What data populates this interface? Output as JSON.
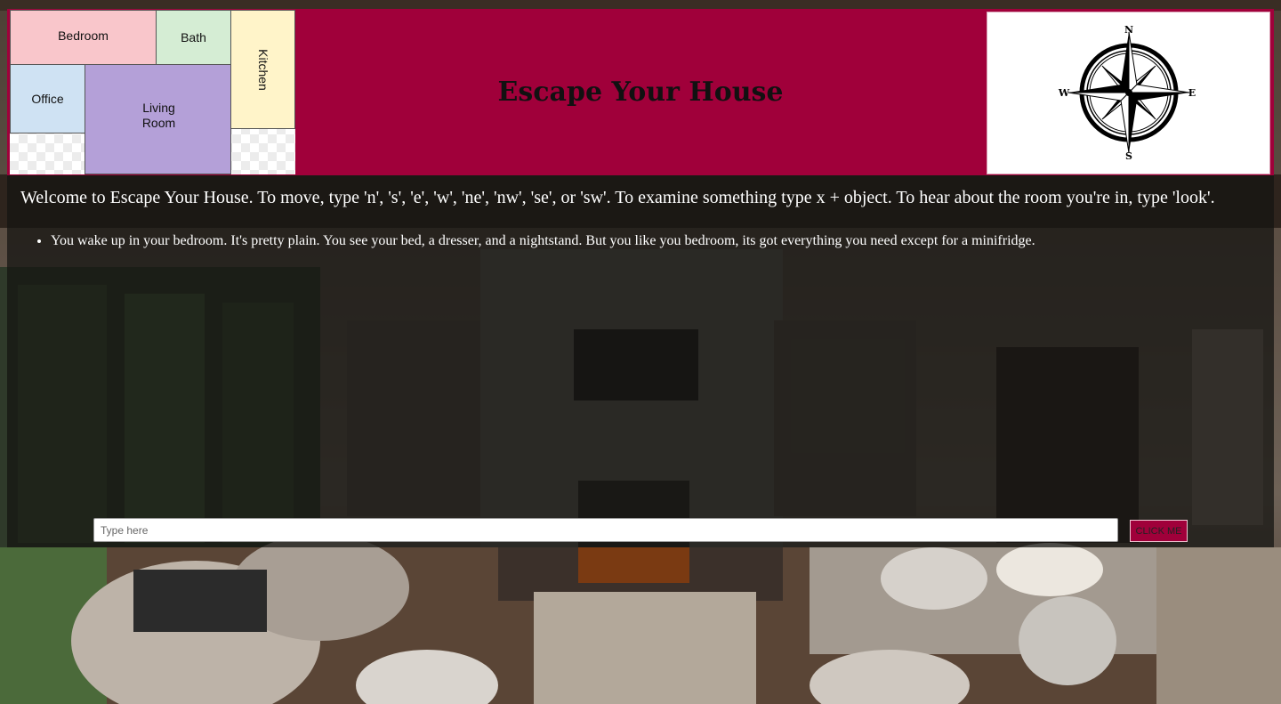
{
  "colors": {
    "header_bg": "#a0003a",
    "panel_bg": "rgba(20,20,18,0.74)",
    "room_bedroom": "#f9c6cb",
    "room_bath": "#d5edd4",
    "room_kitchen": "#fff4c9",
    "room_office": "#cfe2f3",
    "room_living": "#b4a0d8"
  },
  "floorplan": {
    "rooms": {
      "bedroom": "Bedroom",
      "bath": "Bath",
      "kitchen": "Kitchen",
      "office": "Office",
      "living_line1": "Living",
      "living_line2": "Room"
    }
  },
  "header": {
    "title": "Escape Your House"
  },
  "compass": {
    "icon": "compass-rose-icon",
    "n": "N",
    "s": "S",
    "e": "E",
    "w": "W"
  },
  "game": {
    "welcome": "Welcome to Escape Your House. To move, type 'n', 's', 'e', 'w', 'ne', 'nw', 'se', or 'sw'. To examine something type x + object. To hear about the room you're in, type 'look'.",
    "log": [
      "You wake up in your bedroom. It's pretty plain. You see your bed, a dresser, and a nightstand. But you like you bedroom, its got everything you need except for a minifridge."
    ],
    "input_placeholder": "Type here",
    "button_label": "CLICK ME"
  }
}
